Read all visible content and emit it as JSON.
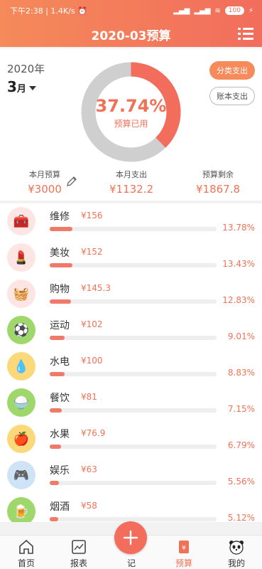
{
  "status_bar": {
    "left": "下午2:38 | 1.4K/s ⏰",
    "battery": "100"
  },
  "header": {
    "title": "2020-03预算"
  },
  "summary": {
    "year": "2020年",
    "month": "3",
    "month_suffix": "月",
    "percent": "37.74%",
    "percent_label": "预算已用",
    "used_fraction": 0.3774,
    "btn_category": "分类支出",
    "btn_account": "账本支出",
    "stats": {
      "budget_label": "本月预算",
      "budget_value": "¥3000",
      "spent_label": "本月支出",
      "spent_value": "¥1132.2",
      "remain_label": "预算剩余",
      "remain_value": "¥1867.8"
    }
  },
  "categories": [
    {
      "name": "维修",
      "amount": "¥156",
      "percent": "13.78%",
      "fill": 0.1378,
      "icon": "toolbox-icon",
      "bg": "#fde5e3"
    },
    {
      "name": "美妆",
      "amount": "¥152",
      "percent": "13.43%",
      "fill": 0.1343,
      "icon": "lipstick-icon",
      "bg": "#fde5e3"
    },
    {
      "name": "购物",
      "amount": "¥145.3",
      "percent": "12.83%",
      "fill": 0.1283,
      "icon": "basket-icon",
      "bg": "#fde5e3"
    },
    {
      "name": "运动",
      "amount": "¥102",
      "percent": "9.01%",
      "fill": 0.0901,
      "icon": "soccer-ball-icon",
      "bg": "#9fd86a"
    },
    {
      "name": "水电",
      "amount": "¥100",
      "percent": "8.83%",
      "fill": 0.0883,
      "icon": "water-drop-icon",
      "bg": "#fbd97a"
    },
    {
      "name": "餐饮",
      "amount": "¥81",
      "percent": "7.15%",
      "fill": 0.0715,
      "icon": "rice-bowl-icon",
      "bg": "#9fd86a"
    },
    {
      "name": "水果",
      "amount": "¥76.9",
      "percent": "6.79%",
      "fill": 0.0679,
      "icon": "apple-icon",
      "bg": "#fbd97a"
    },
    {
      "name": "娱乐",
      "amount": "¥63",
      "percent": "5.56%",
      "fill": 0.0556,
      "icon": "gamepad-icon",
      "bg": "#cfe3f7"
    },
    {
      "name": "烟酒",
      "amount": "¥58",
      "percent": "5.12%",
      "fill": 0.0512,
      "icon": "beer-icon",
      "bg": "#9fd86a"
    }
  ],
  "tabs": {
    "home": "首页",
    "report": "报表",
    "record": "记",
    "budget": "预算",
    "mine": "我的"
  },
  "colors": {
    "accent": "#f07256",
    "header": "#f26d5c",
    "ring_bg": "#cfcfcf"
  }
}
